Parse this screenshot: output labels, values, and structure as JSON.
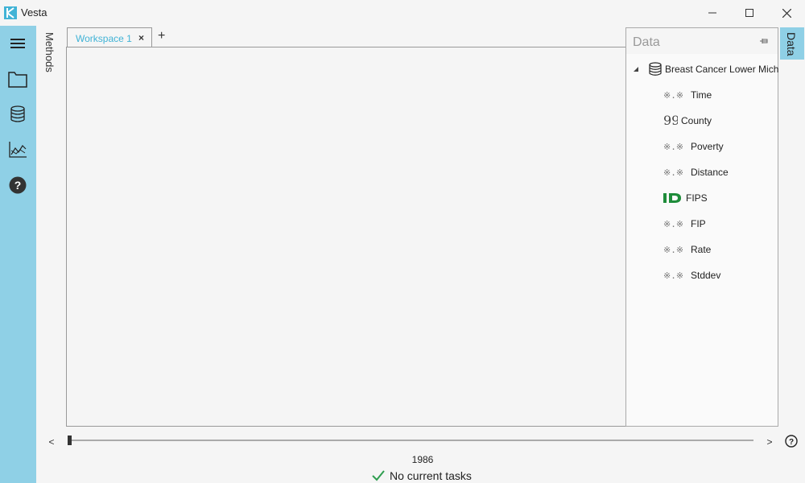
{
  "window": {
    "title": "Vesta"
  },
  "left_toolbar": {
    "items": [
      {
        "icon": "hamburger-menu-icon"
      },
      {
        "icon": "folder-icon"
      },
      {
        "icon": "database-icon"
      },
      {
        "icon": "chart-icon"
      },
      {
        "icon": "help-icon"
      }
    ]
  },
  "methods_tab": {
    "label": "Methods"
  },
  "workspace_tabs": [
    {
      "label": "Workspace 1",
      "close": "×",
      "active": true
    }
  ],
  "add_tab_label": "+",
  "data_panel": {
    "title": "Data",
    "side_tab_label": "Data",
    "dataset": {
      "name": "Breast Cancer Lower Mich",
      "fields": [
        {
          "name": "Time",
          "type": "numeric"
        },
        {
          "name": "County",
          "type": "text"
        },
        {
          "name": "Poverty",
          "type": "numeric"
        },
        {
          "name": "Distance",
          "type": "numeric"
        },
        {
          "name": "FIPS",
          "type": "id"
        },
        {
          "name": "FIP",
          "type": "numeric"
        },
        {
          "name": "Rate",
          "type": "numeric"
        },
        {
          "name": "Stddev",
          "type": "numeric"
        }
      ]
    }
  },
  "timeline": {
    "prev_label": "<",
    "next_label": ">",
    "year": "1986",
    "position": 0
  },
  "status": {
    "text": "No current tasks"
  },
  "colors": {
    "accent": "#8fd0e6",
    "tab_text": "#41b3d6",
    "id_icon": "#1e8c3a",
    "check": "#2e9e4f"
  }
}
